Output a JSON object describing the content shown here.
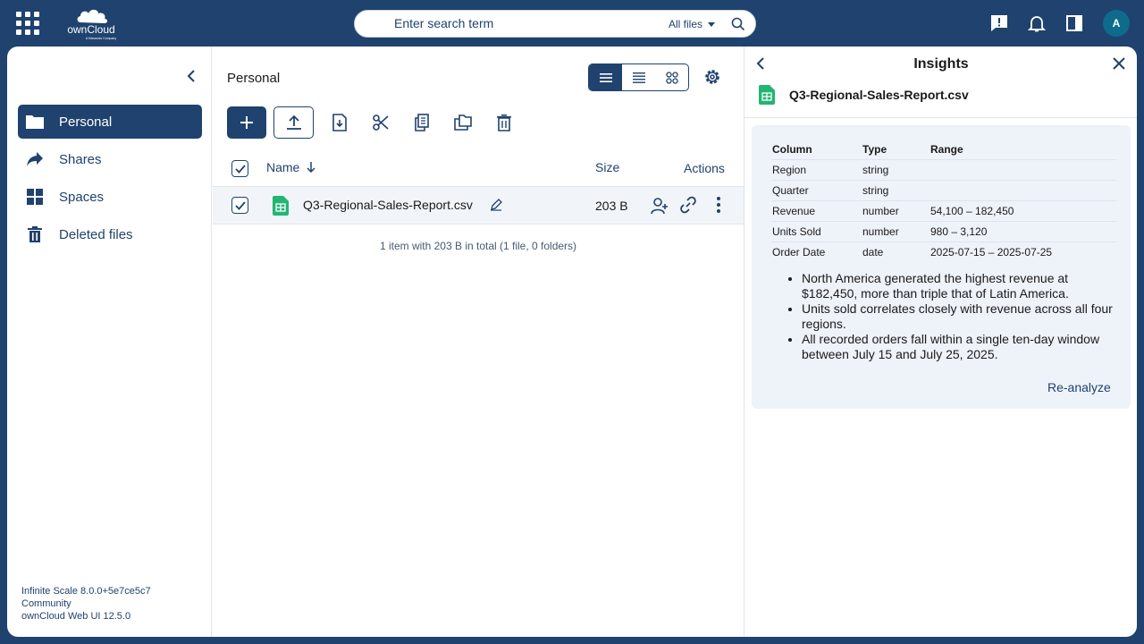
{
  "topbar": {
    "search_placeholder": "Enter search term",
    "search_scope": "All files",
    "avatar_initial": "A"
  },
  "sidebar": {
    "items": [
      {
        "label": "Personal",
        "icon": "folder-icon",
        "active": true
      },
      {
        "label": "Shares",
        "icon": "share-icon",
        "active": false
      },
      {
        "label": "Spaces",
        "icon": "spaces-icon",
        "active": false
      },
      {
        "label": "Deleted files",
        "icon": "trash-icon",
        "active": false
      }
    ],
    "version_lines": [
      "Infinite Scale 8.0.0+5e7ce5c7",
      "Community",
      "ownCloud Web UI 12.5.0"
    ]
  },
  "files": {
    "breadcrumb": "Personal",
    "columns": {
      "name": "Name",
      "size": "Size",
      "actions": "Actions"
    },
    "rows": [
      {
        "name": "Q3-Regional-Sales-Report.csv",
        "size": "203 B",
        "selected": true
      }
    ],
    "summary": "1 item with 203 B in total (1 file, 0 folders)"
  },
  "panel": {
    "title": "Insights",
    "file_name": "Q3-Regional-Sales-Report.csv",
    "table_headers": [
      "Column",
      "Type",
      "Range"
    ],
    "table_rows": [
      [
        "Region",
        "string",
        ""
      ],
      [
        "Quarter",
        "string",
        ""
      ],
      [
        "Revenue",
        "number",
        "54,100 – 182,450"
      ],
      [
        "Units Sold",
        "number",
        "980 – 3,120"
      ],
      [
        "Order Date",
        "date",
        "2025-07-15 – 2025-07-25"
      ]
    ],
    "insights": [
      "North America generated the highest revenue at $182,450, more than triple that of Latin America.",
      "Units sold correlates closely with revenue across all four regions.",
      "All recorded orders fall within a single ten-day window between July 15 and July 25, 2025."
    ],
    "reanalyze_label": "Re-analyze"
  },
  "colors": {
    "brand": "#20426e",
    "sheet_green": "#23b572",
    "avatar": "#0e6b8c"
  }
}
